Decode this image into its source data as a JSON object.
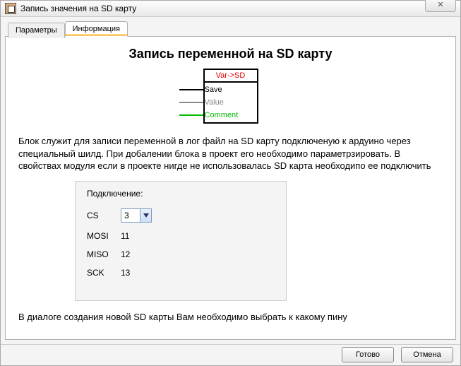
{
  "window": {
    "title": "Запись значения на SD карту",
    "close_glyph": "✕"
  },
  "tabs": {
    "params": "Параметры",
    "info": "Информация"
  },
  "content": {
    "heading": "Запись переменной на SD карту",
    "block": {
      "header": "Var->SD",
      "pin_save": "Save",
      "pin_value": "Value",
      "pin_comment": "Comment"
    },
    "paragraph1": "Блок служит для записи переменной в лог файл на SD карту подключеную к ардуино через специальный шилд. При добалении блока в проект его необходимо параметрзировать. В свойствах модуля если в проекте нигде не использовалась SD карта необходипо ее подключить",
    "connection": {
      "title": "Подключение:",
      "cs_label": "CS",
      "cs_value": "3",
      "rows": {
        "mosi_k": "MOSI",
        "mosi_v": "11",
        "miso_k": "MISO",
        "miso_v": "12",
        "sck_k": "SCK",
        "sck_v": "13"
      }
    },
    "paragraph2": "В диалоге создания новой SD карты Вам необходимо выбрать к какому пину"
  },
  "buttons": {
    "ok": "Готово",
    "cancel": "Отмена"
  }
}
